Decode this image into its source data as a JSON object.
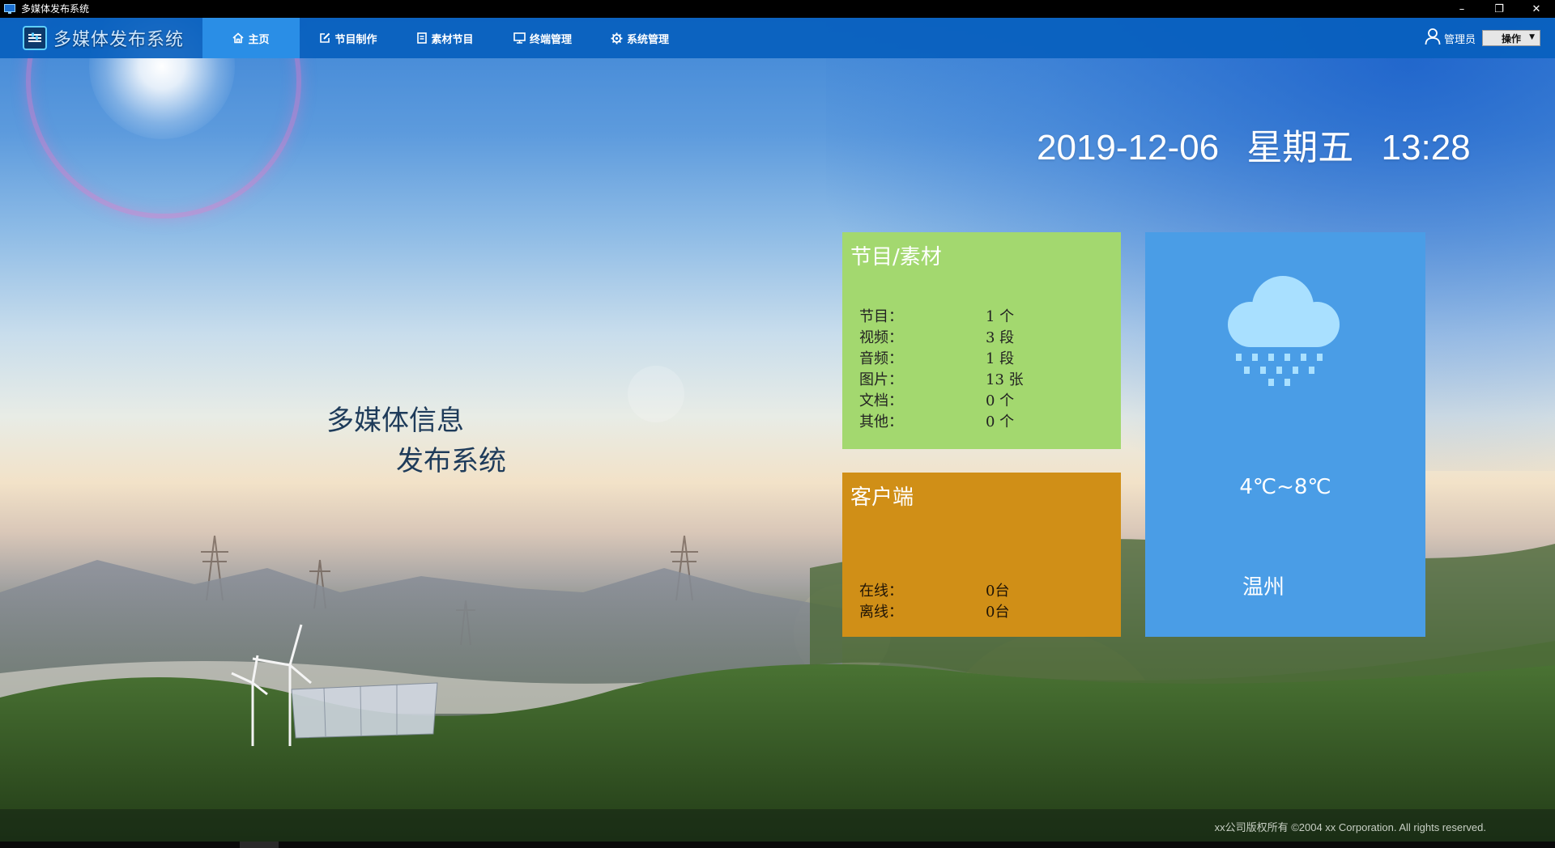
{
  "window": {
    "title": "多媒体发布系统",
    "controls": {
      "minimize": "–",
      "restore": "❐",
      "close": "✕"
    }
  },
  "nav": {
    "brand": "多媒体发布系统",
    "tabs": [
      {
        "label": "主页",
        "icon": "home-icon",
        "active": true
      },
      {
        "label": "节目制作",
        "icon": "edit-icon",
        "active": false
      },
      {
        "label": "素材节目",
        "icon": "document-icon",
        "active": false
      },
      {
        "label": "终端管理",
        "icon": "monitor-icon",
        "active": false
      },
      {
        "label": "系统管理",
        "icon": "gear-icon",
        "active": false
      }
    ],
    "user": "管理员",
    "operate_label": "操作"
  },
  "datetime": {
    "date": "2019-12-06",
    "weekday": "星期五",
    "time": "13:28"
  },
  "hero": {
    "line1": "多媒体信息",
    "line2": "发布系统"
  },
  "program_card": {
    "title": "节目/素材",
    "stats": [
      {
        "label": "节目：",
        "value": "1 个"
      },
      {
        "label": "视频：",
        "value": "3 段"
      },
      {
        "label": "音频：",
        "value": "1 段"
      },
      {
        "label": "图片：",
        "value": "13 张"
      },
      {
        "label": "文档：",
        "value": "0 个"
      },
      {
        "label": "其他：",
        "value": "0 个"
      }
    ]
  },
  "client_card": {
    "title": "客户端",
    "stats": [
      {
        "label": "在线：",
        "value": "0台"
      },
      {
        "label": "离线：",
        "value": "0台"
      }
    ]
  },
  "weather_card": {
    "icon": "rain-cloud-icon",
    "temperature": "4℃~8℃",
    "city": "温州"
  },
  "footer": {
    "copyright": "xx公司版权所有 ©2004 xx Corporation. All rights reserved."
  },
  "colors": {
    "nav_bg": "#0860be",
    "nav_active": "#2a8ee6",
    "program_card": "#a3d86f",
    "client_card": "#d08f17",
    "weather_card": "#4a9de6"
  }
}
